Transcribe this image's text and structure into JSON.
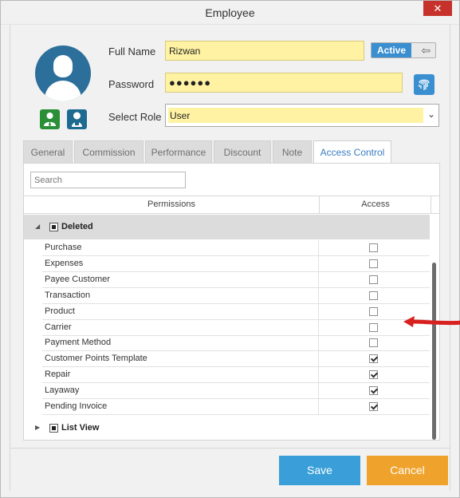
{
  "window": {
    "title": "Employee",
    "close_glyph": "✕"
  },
  "form": {
    "full_name_label": "Full Name",
    "full_name_value": "Rizwan",
    "password_label": "Password",
    "password_value": "●●●●●●",
    "role_label": "Select Role",
    "role_value": "User",
    "status_toggle": "Active"
  },
  "icons": {
    "avatar": "user-avatar-icon",
    "role_green": "employee-icon",
    "role_blue": "manager-icon",
    "fingerprint": "fingerprint-icon",
    "toggle_arrow": "arrow-left-icon"
  },
  "tabs": [
    {
      "label": "General"
    },
    {
      "label": "Commission"
    },
    {
      "label": "Performance"
    },
    {
      "label": "Discount"
    },
    {
      "label": "Note"
    },
    {
      "label": "Access Control"
    }
  ],
  "access": {
    "search_placeholder": "Search",
    "col_permissions": "Permissions",
    "col_access": "Access",
    "groups": [
      {
        "label": "Deleted",
        "expanded": true,
        "items": [
          {
            "name": "Purchase",
            "access": false
          },
          {
            "name": "Expenses",
            "access": false
          },
          {
            "name": "Payee Customer",
            "access": false
          },
          {
            "name": "Transaction",
            "access": false
          },
          {
            "name": "Product",
            "access": false
          },
          {
            "name": "Carrier",
            "access": false
          },
          {
            "name": "Payment Method",
            "access": false
          },
          {
            "name": "Customer Points Template",
            "access": true
          },
          {
            "name": "Repair",
            "access": true
          },
          {
            "name": "Layaway",
            "access": true
          },
          {
            "name": "Pending Invoice",
            "access": true
          }
        ]
      },
      {
        "label": "List View",
        "expanded": false,
        "items": []
      }
    ]
  },
  "buttons": {
    "save": "Save",
    "cancel": "Cancel"
  },
  "colors": {
    "accent": "#3a9fd9",
    "cancel": "#f0a32c",
    "field_highlight": "#fff3a3",
    "active_tab": "#3a7cc2",
    "close": "#c7312b",
    "annotation_arrow": "#d8201f"
  }
}
